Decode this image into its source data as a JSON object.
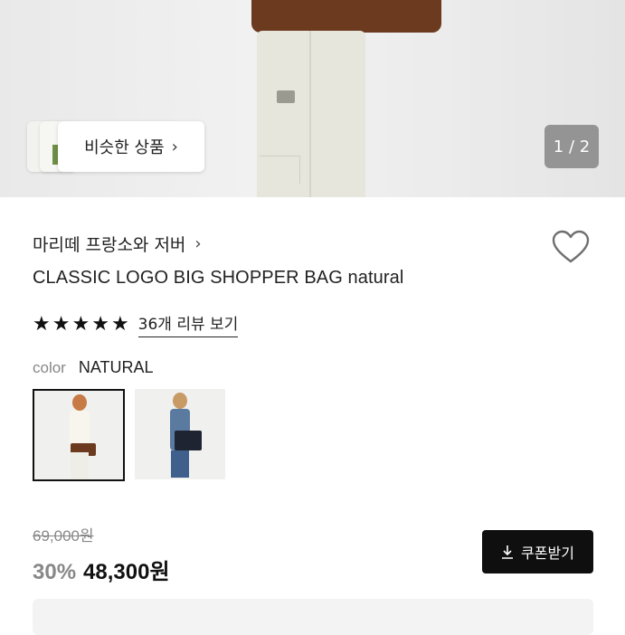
{
  "hero": {
    "similar_label": "비슷한 상품",
    "similar_chevron": "›",
    "image_counter": "1 / 2"
  },
  "product": {
    "brand": "마리떼 프랑소와 저버",
    "brand_chevron": "›",
    "title": "CLASSIC LOGO BIG SHOPPER BAG natural",
    "rating_stars": 5,
    "reviews_link": "36개 리뷰 보기",
    "color_label": "color",
    "color_value": "NATURAL",
    "swatches": [
      {
        "name": "NATURAL",
        "selected": true
      },
      {
        "name": "NAVY",
        "selected": false
      }
    ],
    "original_price": "69,000원",
    "discount": "30%",
    "price": "48,300원",
    "coupon_button": "쿠폰받기"
  },
  "icons": {
    "wishlist": "heart-icon",
    "download": "download-icon",
    "star": "star-icon",
    "chevron": "chevron-right-icon"
  },
  "colors": {
    "accent": "#0f0f0f",
    "muted": "#888888",
    "bag_brown": "#6b3a1f"
  }
}
